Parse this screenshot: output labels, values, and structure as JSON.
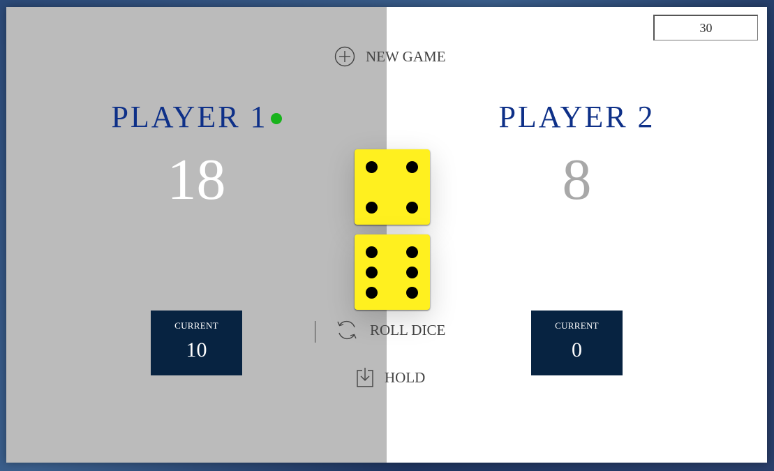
{
  "target_score": "30",
  "buttons": {
    "new_game": "NEW GAME",
    "roll_dice": "ROLL DICE",
    "hold": "HOLD"
  },
  "players": [
    {
      "name": "PLAYER 1",
      "score": "18",
      "current_label": "CURRENT",
      "current": "10",
      "active": true
    },
    {
      "name": "PLAYER 2",
      "score": "8",
      "current_label": "CURRENT",
      "current": "0",
      "active": false
    }
  ],
  "dice": [
    4,
    6
  ],
  "colors": {
    "player_name": "#0e3088",
    "active_dot": "#18b31c",
    "current_box": "#072341",
    "die_face": "#fff01f",
    "active_panel": "#bbbbbb",
    "inactive_panel": "#ffffff"
  },
  "icons": {
    "new_game": "plus-circle-icon",
    "roll_dice": "refresh-icon",
    "hold": "download-icon"
  }
}
